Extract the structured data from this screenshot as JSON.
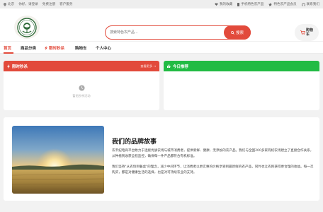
{
  "topbar": {
    "location": "北京",
    "greeting": "你好，请登录",
    "register": "免费注册",
    "service": "客户服务",
    "favorites": "我的收藏",
    "mobile": "手机特色农产品",
    "vip": "特色农产品会员",
    "contact": "联系我们"
  },
  "header": {
    "logo_icon": "farm-logo",
    "search_placeholder": "搜索特色农产品...",
    "search_button": "搜索",
    "cart_line1": "购物",
    "cart_line2": "车"
  },
  "nav": {
    "items": [
      "首页",
      "商品分类",
      "限时秒杀",
      "购物车",
      "个人中心"
    ],
    "active_index": 0
  },
  "flash_sale": {
    "title": "限时秒杀",
    "more": "查看更多 →",
    "empty_text": "暂无秒杀活动"
  },
  "recommend": {
    "title": "今日推荐"
  },
  "story": {
    "title": "我们的品牌故事",
    "p1": "农丰纪电商平台致力于连接优质农场与城市消费者，提供新鲜、健康、无添加的农产品。我们与全国200多家有机农场建立了直接合作关系，从种植到收获全程监控，确保每一件产品都符合有机标准。",
    "p2": "我们坚持\"从农场到餐桌\"的理念，减少中间环节，让消费者以更实惠的价格享受到最新鲜的农产品，同时也让农民获得更合理的收益。每一次购买，都是对健康生活的选择，也是对可持续农业的支持。"
  },
  "colors": {
    "accent": "#e24a3b",
    "green": "#22bb44"
  }
}
